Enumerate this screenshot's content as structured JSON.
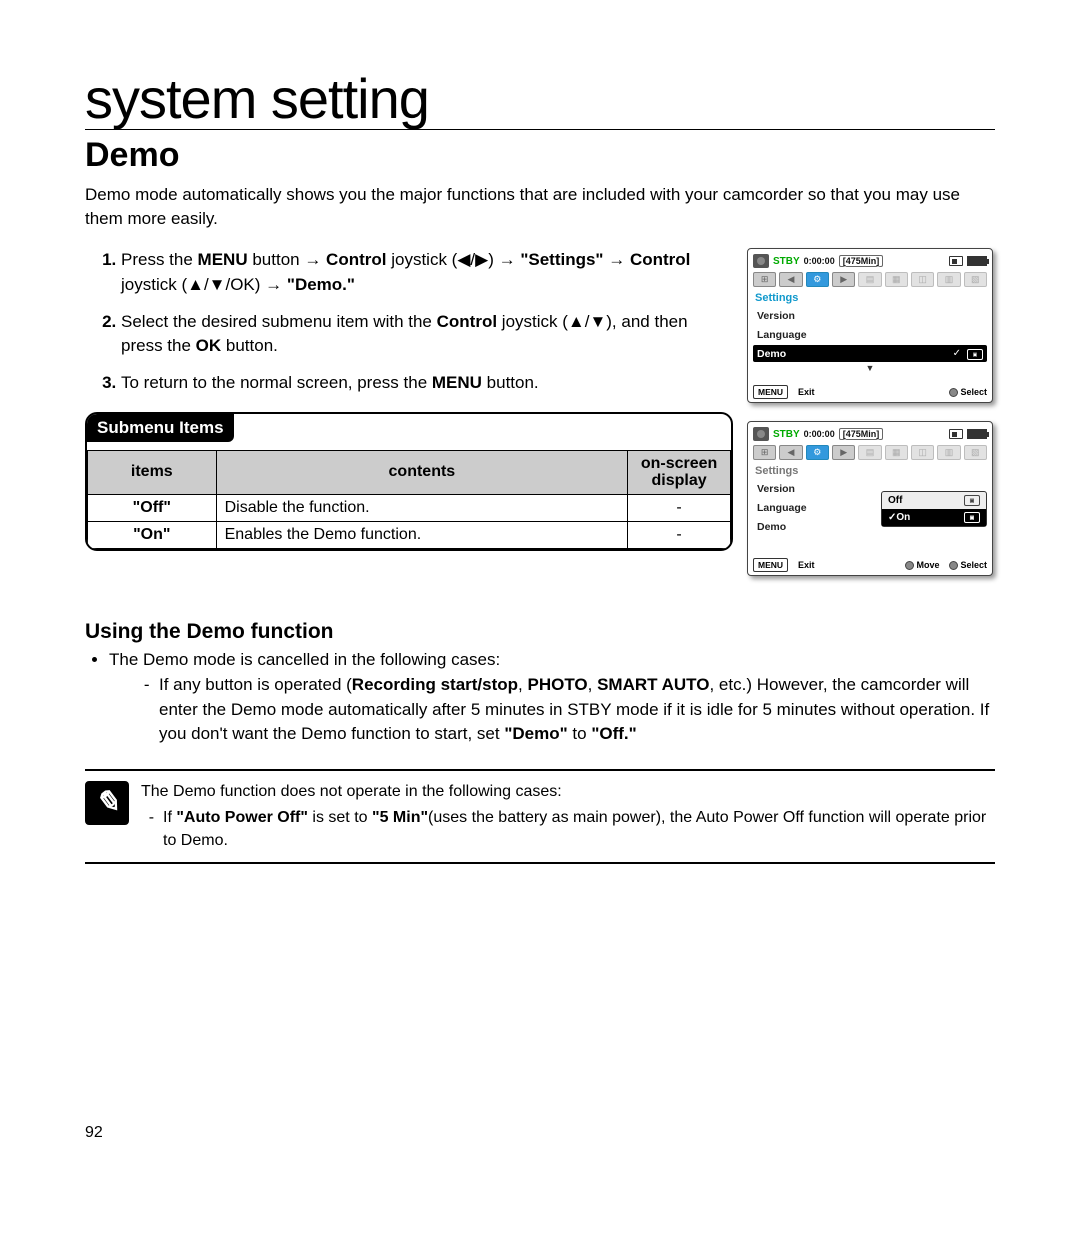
{
  "chapter": "system setting",
  "section": "Demo",
  "intro": "Demo mode automatically shows you the major functions that are included with your camcorder so that you may use them more easily.",
  "steps": {
    "s1a": "Press the ",
    "s1_menu": "MENU",
    "s1b": " button → ",
    "s1_control1": "Control",
    "s1c": " joystick (◀/▶) → ",
    "s1_settings": "\"Settings\"",
    "s1d": " → ",
    "s1_control2": "Control",
    "s1e": " joystick (▲/▼/OK) → ",
    "s1_demo": "\"Demo.\"",
    "s2a": "Select the desired submenu item with the ",
    "s2_control": "Control",
    "s2b": " joystick (▲/▼), and then press the ",
    "s2_ok": "OK",
    "s2c": " button.",
    "s3a": "To return to the normal screen, press the ",
    "s3_menu": "MENU",
    "s3b": " button."
  },
  "submenu": {
    "title": "Submenu Items",
    "headers": {
      "items": "items",
      "contents": "contents",
      "display": "on-screen display"
    },
    "rows": [
      {
        "item": "\"Off\"",
        "content": "Disable the function.",
        "disp": "-"
      },
      {
        "item": "\"On\"",
        "content": "Enables the Demo function.",
        "disp": "-"
      }
    ]
  },
  "using": {
    "title": "Using the Demo function",
    "bullet": "The Demo mode is cancelled in the following cases:",
    "sub_a": "If any button is operated (",
    "sub_b": "Recording start/stop",
    "sub_c": ", ",
    "sub_d": "PHOTO",
    "sub_e": ", ",
    "sub_f": "SMART AUTO",
    "sub_g": ", etc.) However, the camcorder will enter the Demo mode automatically after 5 minutes in STBY mode if it is idle for 5 minutes without operation. If you don't want the Demo function to start, set ",
    "sub_h": "\"Demo\"",
    "sub_i": " to ",
    "sub_j": "\"Off.\""
  },
  "note": {
    "lead": "The Demo function does not operate in the following cases:",
    "a": "If ",
    "b": "\"Auto Power Off\"",
    "c": " is set to ",
    "d": "\"5 Min\"",
    "e": "(uses the battery as main power), the Auto Power Off function will operate prior to Demo."
  },
  "lcd": {
    "stby": "STBY",
    "time": "0:00:00",
    "remain": "[475Min]",
    "settings": "Settings",
    "version": "Version",
    "language": "Language",
    "demo": "Demo",
    "off": "Off",
    "on": "On",
    "menu": "MENU",
    "exit": "Exit",
    "move": "Move",
    "select": "Select"
  },
  "page": "92"
}
